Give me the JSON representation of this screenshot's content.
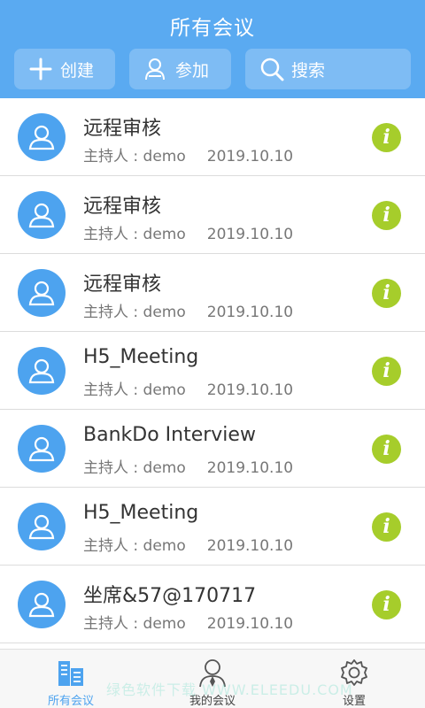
{
  "header": {
    "title": "所有会议",
    "buttons": {
      "create": "创建",
      "join": "参加",
      "search": "搜索"
    }
  },
  "meetings": [
    {
      "name": "远程审核",
      "host": "主持人 : demo",
      "date": "2019.10.10"
    },
    {
      "name": "远程审核",
      "host": "主持人 : demo",
      "date": "2019.10.10"
    },
    {
      "name": "远程审核",
      "host": "主持人 : demo",
      "date": "2019.10.10"
    },
    {
      "name": "H5_Meeting",
      "host": "主持人 : demo",
      "date": "2019.10.10"
    },
    {
      "name": "BankDo Interview",
      "host": "主持人 : demo",
      "date": "2019.10.10"
    },
    {
      "name": "H5_Meeting",
      "host": "主持人 : demo",
      "date": "2019.10.10"
    },
    {
      "name": "坐席&57@170717",
      "host": "主持人 : demo",
      "date": "2019.10.10"
    }
  ],
  "tabs": {
    "all": "所有会议",
    "mine": "我的会议",
    "settings": "设置"
  },
  "watermark": "绿色软件下载 WWW.ELEEDU.COM",
  "colors": {
    "primary": "#5aaaf1",
    "avatar": "#4da3ef",
    "info": "#a6cd2b"
  }
}
